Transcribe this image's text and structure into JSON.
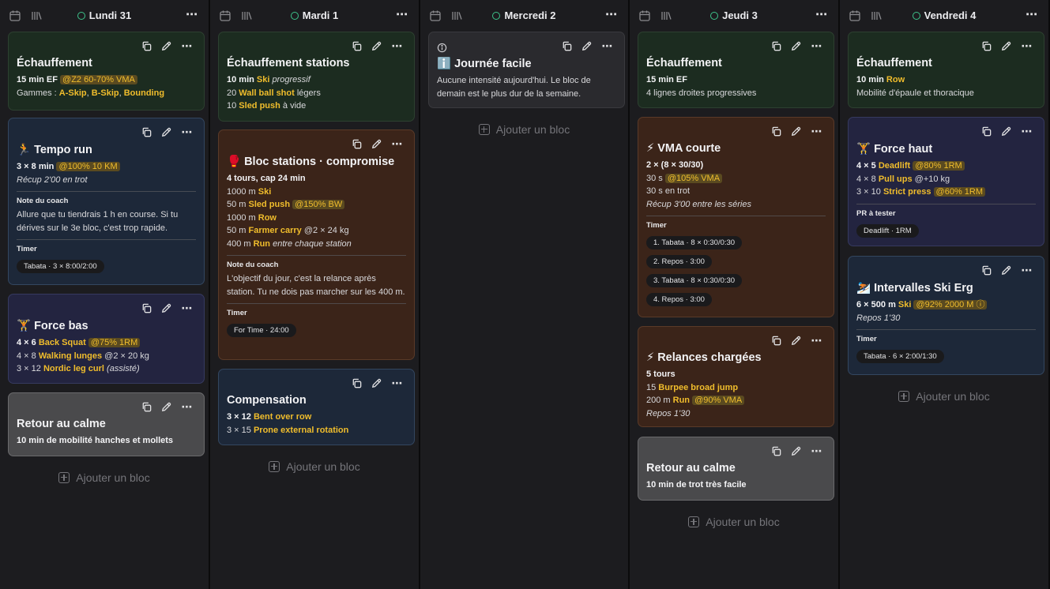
{
  "add_label": "Ajouter un bloc",
  "colors": {
    "accent": "#f0bd2c",
    "dot": "#3dc28a"
  },
  "columns": [
    {
      "day": "Lundi 31",
      "cards": [
        {
          "theme": "green",
          "title": "Échauffement",
          "lines": [
            [
              {
                "t": "15 min EF ",
                "s": "bold"
              },
              {
                "t": "@Z2 60-70% VMA",
                "s": "tag"
              }
            ],
            [
              {
                "t": "Gammes : "
              },
              {
                "t": "A-Skip",
                "s": "hl"
              },
              {
                "t": ", "
              },
              {
                "t": "B-Skip",
                "s": "hl"
              },
              {
                "t": ", "
              },
              {
                "t": "Bounding",
                "s": "hl"
              }
            ]
          ]
        },
        {
          "theme": "blue",
          "emoji": "🏃",
          "title": "Tempo run",
          "lines": [
            [
              {
                "t": "3 × 8 min ",
                "s": "bold"
              },
              {
                "t": "@100% 10 KM",
                "s": "tag"
              }
            ],
            [
              {
                "t": "Récup 2'00 en trot",
                "s": "ital"
              }
            ]
          ],
          "coach_label": "Note du coach",
          "coach": "Allure que tu tiendrais 1 h en course. Si tu dérives sur le 3e bloc, c'est trop rapide.",
          "timer_label": "Timer",
          "pills": [
            "Tabata · 3 × 8:00/2:00"
          ]
        },
        {
          "theme": "purple",
          "emoji": "🏋️",
          "title": "Force bas",
          "lines": [
            [
              {
                "t": "4 × 6 ",
                "s": "bold"
              },
              {
                "t": "Back Squat",
                "s": "hl"
              },
              {
                "t": " "
              },
              {
                "t": "@75% 1RM",
                "s": "tag"
              }
            ],
            [
              {
                "t": "4 × 8 "
              },
              {
                "t": "Walking lunges",
                "s": "hl"
              },
              {
                "t": " @2 × 20 kg"
              }
            ],
            [
              {
                "t": "3 × 12 "
              },
              {
                "t": "Nordic leg curl",
                "s": "hl"
              },
              {
                "t": " "
              },
              {
                "t": "(assisté)",
                "s": "ital"
              }
            ]
          ]
        },
        {
          "theme": "grey",
          "title": "Retour au calme",
          "lines": [
            [
              {
                "t": "10 min de mobilité hanches et mollets",
                "s": "bold"
              }
            ]
          ]
        }
      ]
    },
    {
      "day": "Mardi 1",
      "cards": [
        {
          "theme": "green",
          "title": "Échauffement stations",
          "lines": [
            [
              {
                "t": "10 min ",
                "s": "bold"
              },
              {
                "t": "Ski",
                "s": "hl"
              },
              {
                "t": " "
              },
              {
                "t": "progressif",
                "s": "ital"
              }
            ],
            [
              {
                "t": "20 "
              },
              {
                "t": "Wall ball shot",
                "s": "hl"
              },
              {
                "t": " légers"
              }
            ],
            [
              {
                "t": "10 "
              },
              {
                "t": "Sled push",
                "s": "hl"
              },
              {
                "t": " à vide"
              }
            ]
          ]
        },
        {
          "theme": "brown",
          "emoji": "🥊",
          "title": "Bloc stations · compromise",
          "lines": [
            [
              {
                "t": "4 tours, cap 24 min",
                "s": "bold"
              }
            ],
            [
              {
                "t": "1000 m "
              },
              {
                "t": "Ski",
                "s": "hl"
              }
            ],
            [
              {
                "t": "50 m "
              },
              {
                "t": "Sled push",
                "s": "hl"
              },
              {
                "t": " "
              },
              {
                "t": "@150% BW",
                "s": "tag"
              }
            ],
            [
              {
                "t": "1000 m "
              },
              {
                "t": "Row",
                "s": "hl"
              }
            ],
            [
              {
                "t": "50 m "
              },
              {
                "t": "Farmer carry",
                "s": "hl"
              },
              {
                "t": " @2 × 24 kg"
              }
            ],
            [
              {
                "t": "400 m "
              },
              {
                "t": "Run",
                "s": "hl"
              },
              {
                "t": " "
              },
              {
                "t": "entre chaque station",
                "s": "ital"
              }
            ]
          ],
          "coach_label": "Note du coach",
          "coach": "L'objectif du jour, c'est la relance après station. Tu ne dois pas marcher sur les 400 m.",
          "timer_label": "Timer",
          "pills": [
            "For Time · 24:00"
          ]
        },
        {
          "theme": "blue",
          "title": "Compensation",
          "lines": [
            [
              {
                "t": "3 × 12 ",
                "s": "bold"
              },
              {
                "t": "Bent over row",
                "s": "hl"
              }
            ],
            [
              {
                "t": "3 × 15 "
              },
              {
                "t": "Prone external rotation",
                "s": "hl"
              }
            ]
          ]
        }
      ]
    },
    {
      "day": "Mercredi 2",
      "cards": [
        {
          "theme": "dark",
          "info": true,
          "emoji": "ℹ️",
          "title": "Journée facile",
          "lines": [
            [
              {
                "t": "Aucune intensité aujourd'hui. Le bloc de"
              }
            ],
            [
              {
                "t": "demain est le plus dur de la semaine."
              }
            ]
          ]
        }
      ]
    },
    {
      "day": "Jeudi 3",
      "cards": [
        {
          "theme": "green",
          "title": "Échauffement",
          "lines": [
            [
              {
                "t": "15 min EF",
                "s": "bold"
              }
            ],
            [
              {
                "t": "4 lignes droites progressives"
              }
            ]
          ]
        },
        {
          "theme": "brown",
          "emoji": "⚡",
          "title": "VMA courte",
          "lines": [
            [
              {
                "t": "2 × (8 × 30/30)",
                "s": "bold"
              }
            ],
            [
              {
                "t": "30 s "
              },
              {
                "t": "@105% VMA",
                "s": "tag"
              }
            ],
            [
              {
                "t": "30 s en trot"
              }
            ],
            [
              {
                "t": "Récup 3'00 entre les séries",
                "s": "ital"
              }
            ]
          ],
          "timer_label": "Timer",
          "pills": [
            "1. Tabata · 8 × 0:30/0:30",
            "2. Repos · 3:00",
            "3. Tabata · 8 × 0:30/0:30",
            "4. Repos · 3:00"
          ]
        },
        {
          "theme": "brown",
          "emoji": "⚡",
          "title": "Relances chargées",
          "lines": [
            [
              {
                "t": "5 tours",
                "s": "bold"
              }
            ],
            [
              {
                "t": "15 "
              },
              {
                "t": "Burpee broad jump",
                "s": "hl"
              }
            ],
            [
              {
                "t": "200 m "
              },
              {
                "t": "Run",
                "s": "hl"
              },
              {
                "t": " "
              },
              {
                "t": "@90% VMA",
                "s": "tag"
              }
            ],
            [
              {
                "t": "Repos 1'30",
                "s": "ital"
              }
            ]
          ]
        },
        {
          "theme": "grey",
          "title": "Retour au calme",
          "lines": [
            [
              {
                "t": "10 min de trot très facile",
                "s": "bold"
              }
            ]
          ]
        }
      ]
    },
    {
      "day": "Vendredi 4",
      "cards": [
        {
          "theme": "green",
          "title": "Échauffement",
          "lines": [
            [
              {
                "t": "10 min ",
                "s": "bold"
              },
              {
                "t": "Row",
                "s": "hl"
              }
            ],
            [
              {
                "t": "Mobilité d'épaule et thoracique"
              }
            ]
          ]
        },
        {
          "theme": "purple",
          "emoji": "🏋️",
          "title": "Force haut",
          "lines": [
            [
              {
                "t": "4 × 5 ",
                "s": "bold"
              },
              {
                "t": "Deadlift",
                "s": "hl"
              },
              {
                "t": " "
              },
              {
                "t": "@80% 1RM",
                "s": "tag"
              }
            ],
            [
              {
                "t": "4 × 8 "
              },
              {
                "t": "Pull ups",
                "s": "hl"
              },
              {
                "t": " @+10 kg"
              }
            ],
            [
              {
                "t": "3 × 10 "
              },
              {
                "t": "Strict press",
                "s": "hl"
              },
              {
                "t": " "
              },
              {
                "t": "@60% 1RM",
                "s": "tag"
              }
            ]
          ],
          "timer_label": "PR à tester",
          "pills": [
            "Deadlift · 1RM"
          ]
        },
        {
          "theme": "blue",
          "emoji": "⛷️",
          "title": "Intervalles Ski Erg",
          "lines": [
            [
              {
                "t": "6 × 500 m ",
                "s": "bold"
              },
              {
                "t": "Ski",
                "s": "hl"
              },
              {
                "t": " "
              },
              {
                "t": "@92% 2000 M ⓘ",
                "s": "tag"
              }
            ],
            [
              {
                "t": "Repos 1'30",
                "s": "ital"
              }
            ]
          ],
          "timer_label": "Timer",
          "pills": [
            "Tabata · 6 × 2:00/1:30"
          ]
        }
      ]
    }
  ]
}
